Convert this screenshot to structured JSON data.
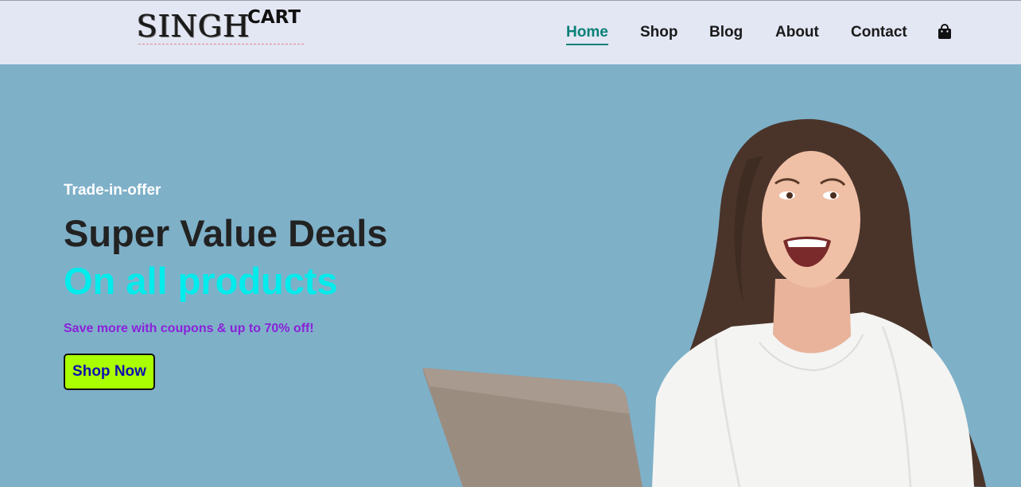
{
  "header": {
    "logo_main": "SINGH",
    "logo_sup": "CART",
    "nav": [
      {
        "label": "Home",
        "active": true
      },
      {
        "label": "Shop",
        "active": false
      },
      {
        "label": "Blog",
        "active": false
      },
      {
        "label": "About",
        "active": false
      },
      {
        "label": "Contact",
        "active": false
      }
    ],
    "cart_icon": "shopping-bag-icon"
  },
  "hero": {
    "eyebrow": "Trade-in-offer",
    "headline": "Super Value Deals",
    "subheadline": "On all products",
    "tagline": "Save more with coupons & up to 70% off!",
    "button_label": "Shop Now"
  },
  "colors": {
    "header_bg": "#e3e6f3",
    "hero_bg": "#7eb0c8",
    "accent": "#088178",
    "subheadline": "#00ecec",
    "tagline": "#8a22d9",
    "button_bg": "#aaff00",
    "button_text": "#1010b0"
  }
}
